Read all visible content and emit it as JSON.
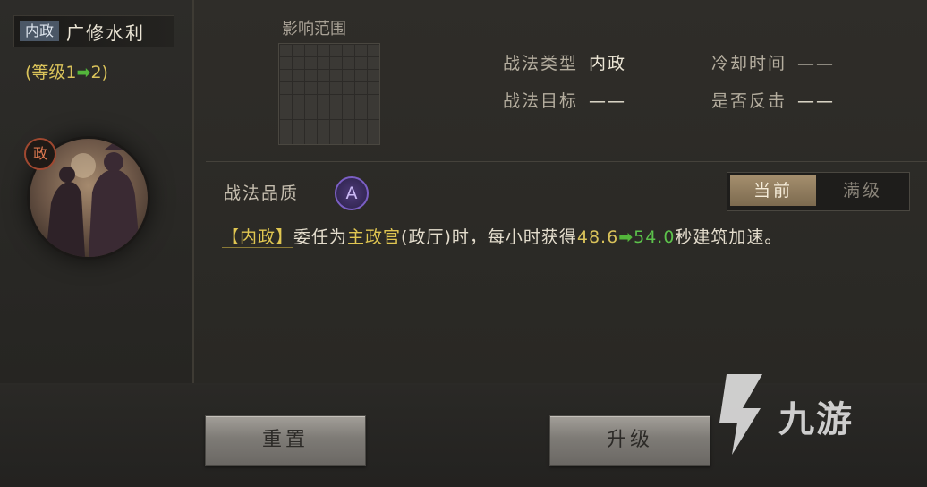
{
  "skill": {
    "type_badge": "内政",
    "name": "广修水利",
    "level_prefix": "(等级1",
    "level_arrow": "➡",
    "level_suffix": "2)",
    "portrait_badge": "政"
  },
  "range": {
    "label": "影响范围"
  },
  "info": {
    "type_key": "战法类型",
    "type_val": "内政",
    "target_key": "战法目标",
    "target_val": "——",
    "cooldown_key": "冷却时间",
    "cooldown_val": "——",
    "counter_key": "是否反击",
    "counter_val": "——"
  },
  "quality": {
    "label": "战法品质",
    "grade": "A"
  },
  "toggle": {
    "current": "当前",
    "max": "满级"
  },
  "description": {
    "tag": "【内政】",
    "part1": "委任为",
    "highlight": "主政官",
    "part2": "(政厅)时，每小时获得",
    "current_value": "48.6",
    "arrow": "➡",
    "next_value": "54.0",
    "part3": "秒建筑加速。"
  },
  "buttons": {
    "reset": "重置",
    "upgrade": "升级"
  },
  "watermark": {
    "text": "九游"
  }
}
